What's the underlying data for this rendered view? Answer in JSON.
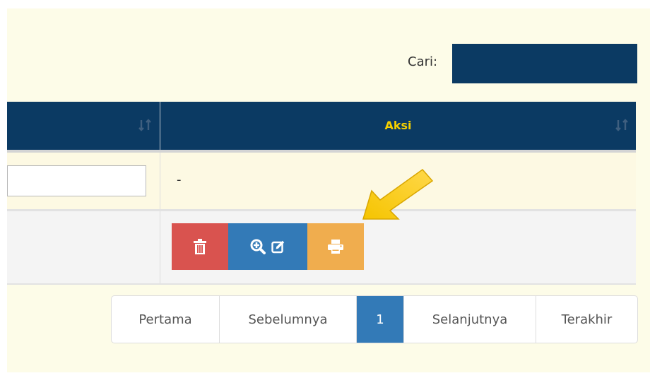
{
  "search": {
    "label": "Cari:",
    "value": ""
  },
  "table": {
    "columns": [
      {
        "label": ""
      },
      {
        "label": "Aksi"
      }
    ],
    "rows": [
      {
        "input_value": "",
        "aksi_text": "-"
      },
      {
        "actions": [
          {
            "name": "delete",
            "icon": "trash-icon",
            "color": "#d9534f"
          },
          {
            "name": "view-edit",
            "icons": [
              "zoom-in-icon",
              "edit-icon"
            ],
            "color": "#337ab7"
          },
          {
            "name": "print",
            "icon": "printer-icon",
            "color": "#f0ad4e"
          }
        ]
      }
    ]
  },
  "pagination": {
    "first": "Pertama",
    "prev": "Sebelumnya",
    "current": "1",
    "next": "Selanjutnya",
    "last": "Terakhir"
  },
  "colors": {
    "header_bg": "#0b3a63",
    "header_text": "#f5d000",
    "page_bg": "#fdfce8",
    "active_page": "#337ab7"
  }
}
